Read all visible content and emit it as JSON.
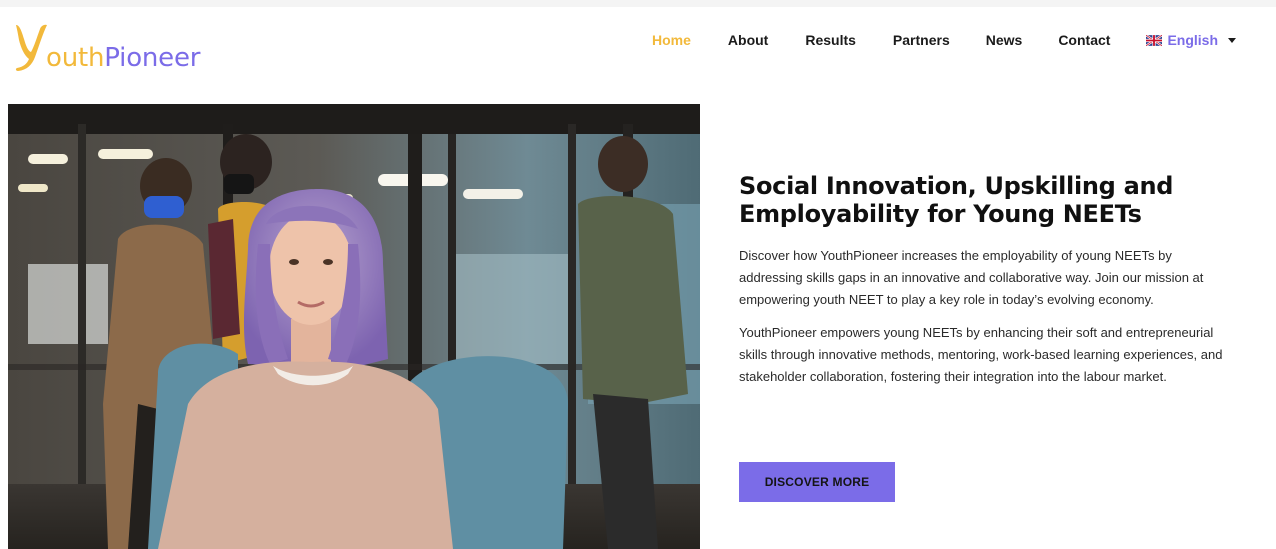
{
  "brand": {
    "logo_letter": "Y",
    "logo_outh": "outh",
    "logo_pioneer": "Pioneer",
    "yellow": "#f2b93b",
    "purple": "#7b6ce8"
  },
  "nav": {
    "items": [
      {
        "label": "Home",
        "active": true
      },
      {
        "label": "About",
        "active": false
      },
      {
        "label": "Results",
        "active": false
      },
      {
        "label": "Partners",
        "active": false
      },
      {
        "label": "News",
        "active": false
      },
      {
        "label": "Contact",
        "active": false
      }
    ],
    "language": {
      "label": "English",
      "flag_icon": "uk-flag-icon",
      "caret_icon": "caret-down-icon"
    }
  },
  "hero": {
    "title": "Social Innovation, Upskilling and Employability for Young NEETs",
    "paragraph_1": "Discover how YouthPioneer increases the employability of young NEETs by addressing skills gaps in an innovative and collaborative way. Join our mission at empowering youth NEET to play a key role in today’s evolving economy.",
    "paragraph_2": "YouthPioneer empowers young NEETs by enhancing their soft and entrepreneurial skills through innovative methods, mentoring, work-based learning experiences, and stakeholder collaboration, fostering their integration into the labour market.",
    "cta_label": "DISCOVER MORE",
    "cta_color": "#7b6ce8"
  }
}
